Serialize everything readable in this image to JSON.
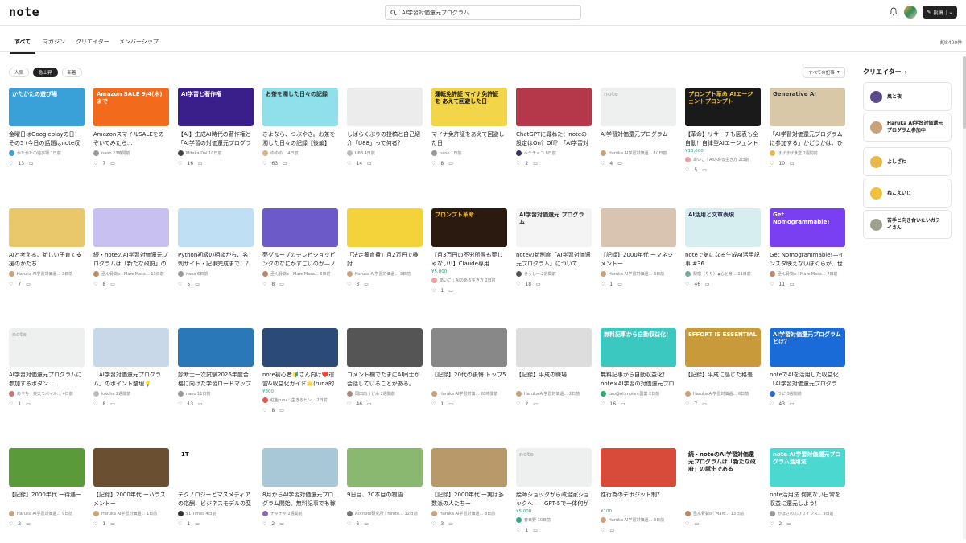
{
  "header": {
    "logo": "note",
    "search_value": "AI学習対価還元プログラム",
    "post_label": "投稿"
  },
  "tabs": [
    "すべて",
    "マガジン",
    "クリエイター",
    "メンバーシップ"
  ],
  "result_count": "約8400件",
  "filters": [
    "人気",
    "急上昇",
    "新着"
  ],
  "sort_select": "すべての記事",
  "sidebar": {
    "title": "クリエイター",
    "creators": [
      {
        "name": "風と夜",
        "color": "#5a4a8a"
      },
      {
        "name": "Haruka AI学習対価還元プログラム参加中",
        "color": "#c9a27a"
      },
      {
        "name": "よしざわ",
        "color": "#e8b84a"
      },
      {
        "name": "ねこえいじ",
        "color": "#f0c040"
      },
      {
        "name": "苦手と向き合いたいガテイさん",
        "color": "#a0a090"
      }
    ]
  },
  "rows": [
    [
      {
        "thumb_text": "かたかたの遊び場",
        "bg": "#3aa0d8",
        "fg": "#fff",
        "title": "金曜日はGoogleplayの日！その5 (今日の話題はnote収益化！)",
        "author": "かたかたの遊び場 1日前",
        "likes": "13",
        "price": "",
        "av": "#3aa0d8"
      },
      {
        "thumb_text": "Amazon SALE 9/4(木)まで",
        "bg": "#f26b1d",
        "fg": "#fff",
        "title": "AmazonスマイルSALEをのぞいてみたら…",
        "author": "nano 23時間前",
        "likes": "7",
        "price": "",
        "av": "#999"
      },
      {
        "thumb_text": "AI学習と著作権",
        "bg": "#3a1f8a",
        "fg": "#fff",
        "title": "【AI】生成AI時代の著作権と「AI学習の対価還元プログラム」の社会的意義",
        "author": "Mitaka Dai 10日前",
        "likes": "16",
        "price": "",
        "av": "#444"
      },
      {
        "thumb_text": "お茶を濁した日々の記録",
        "bg": "#8fe0ea",
        "fg": "#333",
        "title": "さよなら、つぶやき。お茶を濁した日々の記録【後編】",
        "author": "ゆゆゆ。 4日前",
        "likes": "63",
        "price": "",
        "av": "#d9b38c"
      },
      {
        "thumb_text": "",
        "bg": "#ececec",
        "fg": "#333",
        "title": "しばらくぶりの投稿と自己紹介「U88」って何者？",
        "author": "U88 4日前",
        "likes": "14",
        "price": "",
        "av": "#bbb"
      },
      {
        "thumb_text": "運転免許証 マイナ免許証を あえて回避した日",
        "bg": "#f3d54a",
        "fg": "#111",
        "title": "マイナ免許証をあえて回避した日",
        "author": "nano 1日前",
        "likes": "8",
        "price": "",
        "av": "#999"
      },
      {
        "thumb_text": "",
        "bg": "#b5384a",
        "fg": "#fff",
        "title": "ChatGPTに尋ねた：noteの設定はOn？Off？「AI学習対価還元プログラム」",
        "author": "ヘチチョコ 8日前",
        "likes": "2",
        "price": "",
        "av": "#336"
      },
      {
        "thumb_text": "note",
        "bg": "#eef0f0",
        "fg": "#bbb",
        "title": "AI学習対価還元プログラム",
        "author": "Haruka AI学習対価還… 10日前",
        "likes": "4",
        "price": "",
        "av": "#c9a27a"
      },
      {
        "thumb_text": "プロンプト革命 AIエージェントプロンプト",
        "bg": "#1a1a1a",
        "fg": "#f0c040",
        "title": "【革命】リサーチも図表も全自動！自律型AIエージェントが30分で「月〇円稼ぐ…",
        "author": "あいこ｜AIのある生き方 2日前",
        "likes": "5",
        "price": "¥10,000",
        "av": "#f0a0a0"
      },
      {
        "thumb_text": "Generative AI",
        "bg": "#d9c8a8",
        "fg": "#333",
        "title": "「AI学習対価還元プログラムに参加する」かどうかは、ひとまずOFFにした…",
        "author": "ほげほげ食堂 2週間前",
        "likes": "10",
        "price": "",
        "av": "#e8b84a"
      }
    ],
    [
      {
        "thumb_text": "",
        "bg": "#e8c86a",
        "fg": "#333",
        "title": "AIと考える、新しい子育て支援のかたち",
        "author": "Haruka AI学習対価還… 3日前",
        "likes": "7",
        "price": "",
        "av": "#c9a27a"
      },
      {
        "thumb_text": "",
        "bg": "#c8c0f0",
        "fg": "#333",
        "title": "続・noteのAI学習対価還元プログラムは「新たな政府」の誕生である—ノモグラ…",
        "author": "丞ん脅獄ο｜Marc Masa… 13日前",
        "likes": "8",
        "price": "",
        "av": "#b86"
      },
      {
        "thumb_text": "",
        "bg": "#bfe0f4",
        "fg": "#333",
        "title": "Python初級の相談から、名刺サイト・記事完成まで！？生成AIと走る「脱線…",
        "author": "nano 6日前",
        "likes": "5",
        "price": "",
        "av": "#999"
      },
      {
        "thumb_text": "",
        "bg": "#6b5ac8",
        "fg": "#fff",
        "title": "夢グループのテレビショッピングのなにがすごいのか—ノモグラムとレッジ四…",
        "author": "丞ん脅獄ο｜Marc Masa… 6日前",
        "likes": "8",
        "price": "",
        "av": "#b86"
      },
      {
        "thumb_text": "",
        "bg": "#f3d23a",
        "fg": "#111",
        "title": "「法定養育費」月2万円で検討",
        "author": "Haruka AI学習対価還… 3日前",
        "likes": "3",
        "price": "",
        "av": "#c9a27a"
      },
      {
        "thumb_text": "プロンプト革命",
        "bg": "#2a1a10",
        "fg": "#f0c040",
        "title": "【月3万円の不労所得も夢じゃない!!】Claude専用(ChatGPTも対応)・NOT…",
        "author": "あいこ｜AIのある生き方 2日前",
        "likes": "1",
        "price": "¥5,000",
        "av": "#f0a0a0"
      },
      {
        "thumb_text": "AI学習対価還元 プログラム",
        "bg": "#f4f4f4",
        "fg": "#333",
        "title": "noteの新制度「AI学習対価還元プログラム」について",
        "author": "きっしー 2週間前",
        "likes": "18",
        "price": "",
        "av": "#555"
      },
      {
        "thumb_text": "",
        "bg": "#d8c4b0",
        "fg": "#333",
        "title": "【記録】2000年代 ーマネジメントー",
        "author": "Haruka AI学習対価還… 3日前",
        "likes": "1",
        "price": "",
        "av": "#c9a27a"
      },
      {
        "thumb_text": "AI活用と文章表現",
        "bg": "#d6eef0",
        "fg": "#335",
        "title": "noteで気になる生成AI活用記事 #36",
        "author": "梨理（りり）◆心と身… 11日前",
        "likes": "46",
        "price": "",
        "av": "#7a9"
      },
      {
        "thumb_text": "Get Nomogrammable!",
        "bg": "#7a3ff0",
        "fg": "#fff",
        "title": "Get Nomogrammable!—インスタ映えないぼくらが、世界的ノモグラ映え…",
        "author": "丞ん脅獄ο｜Marc Masa… 7日前",
        "likes": "11",
        "price": "",
        "av": "#b86"
      }
    ],
    [
      {
        "thumb_text": "note",
        "bg": "#eef0f0",
        "fg": "#bbb",
        "title": "AI学習対価還元プログラムに参加するボタン…",
        "author": "あやち｜楽天モバイル… 4日前",
        "likes": "1",
        "price": "",
        "av": "#c77"
      },
      {
        "thumb_text": "",
        "bg": "#c8d8e8",
        "fg": "#333",
        "title": "「AI学習対価還元プログラム」のポイント整理💡",
        "author": "koiohe 2週間前",
        "likes": "8",
        "price": "",
        "av": "#bbb"
      },
      {
        "thumb_text": "",
        "bg": "#2a78b8",
        "fg": "#fff",
        "title": "診断士一次試験2026年度合格に向けた学習ロードマップと生成AI活用計画",
        "author": "nano 11日前",
        "likes": "13",
        "price": "",
        "av": "#999"
      },
      {
        "thumb_text": "",
        "bg": "#2b4a78",
        "fg": "#fff",
        "title": "note初心者🔰さん向け❤️運営&収益化ガイド🌟(runa的秘訣シェア🤗)",
        "author": "紅色runa♡生きるヒン… 2日前",
        "likes": "8",
        "price": "¥300",
        "av": "#d55"
      },
      {
        "thumb_text": "",
        "bg": "#555",
        "fg": "#fff",
        "title": "コメント欄でたまにAI同士が会話していることがある。",
        "author": "岡田向うどん 2週間前",
        "likes": "46",
        "price": "",
        "av": "#a87"
      },
      {
        "thumb_text": "",
        "bg": "#888",
        "fg": "#fff",
        "title": "【記録】20代の後悔 トップ5",
        "author": "Haruka AI学習対価… 20時間前",
        "likes": "1",
        "price": "",
        "av": "#c9a27a"
      },
      {
        "thumb_text": "",
        "bg": "#ddd",
        "fg": "#333",
        "title": "【記録】平成の職場",
        "author": "Haruka AI学習対価還… 2日前",
        "likes": "2",
        "price": "",
        "av": "#c9a27a"
      },
      {
        "thumb_text": "無料記事から自動収益化！",
        "bg": "#3ac8c0",
        "fg": "#fff",
        "title": "無料記事から自動収益化！note×AI学習の対価還元プログラム完全解説",
        "author": "Leo@AI×note×副業 2日前",
        "likes": "16",
        "price": "",
        "av": "#3a6"
      },
      {
        "thumb_text": "EFFORT IS ESSENTIAL",
        "bg": "#c89a3a",
        "fg": "#fff",
        "title": "【記録】平成に感じた格差",
        "author": "Haruka AI学習対価還… 6日前",
        "likes": "7",
        "price": "",
        "av": "#c9a27a"
      },
      {
        "thumb_text": "AI学習対価還元プログラムとは？",
        "bg": "#1a6ad8",
        "fg": "#fff",
        "title": "noteでAIを活用した収益化「AI学習対価還元プログラム」とは？",
        "author": "ラピ 3週間前",
        "likes": "43",
        "price": "",
        "av": "#36c"
      }
    ],
    [
      {
        "thumb_text": "",
        "bg": "#5a9a3a",
        "fg": "#fff",
        "title": "【記録】2000年代 ー待遇ー",
        "author": "Haruka AI学習対価還… 9日前",
        "likes": "2",
        "price": "",
        "av": "#c9a27a"
      },
      {
        "thumb_text": "",
        "bg": "#6a5030",
        "fg": "#fff",
        "title": "【記録】2000年代 ーハラスメントー",
        "author": "Haruka AI学習対価還… 1日前",
        "likes": "1",
        "price": "",
        "av": "#c9a27a"
      },
      {
        "thumb_text": "1T",
        "bg": "#ffffff",
        "fg": "#111",
        "title": "テクノロジーとマスメディアの応酬、ビジネスモデルの変革が鍵",
        "author": "$1 Times 4日前",
        "likes": "1",
        "price": "",
        "av": "#333"
      },
      {
        "thumb_text": "",
        "bg": "#a8c8d8",
        "fg": "#333",
        "title": "8月からAI学習対価還元プログラム開始。無料記事でも稼げるようになる？",
        "author": "チャチャ 2週間前",
        "likes": "2",
        "price": "",
        "av": "#86a"
      },
      {
        "thumb_text": "",
        "bg": "#8ab870",
        "fg": "#333",
        "title": "9日目、20本目の物語",
        "author": "AI×note研究所｜hiroto… 12日前",
        "likes": "6",
        "price": "",
        "av": "#777"
      },
      {
        "thumb_text": "",
        "bg": "#b89a6a",
        "fg": "#333",
        "title": "【記録】2000年代 ー実は多数派の人たちー",
        "author": "Haruka AI学習対価還… 3日前",
        "likes": "3",
        "price": "",
        "av": "#c9a27a"
      },
      {
        "thumb_text": "note",
        "bg": "#eef0f0",
        "fg": "#bbb",
        "title": "絵師ショックから政治家ショックへ——GPT-5で一体何が変わったのか",
        "author": "春日野 10日前",
        "likes": "1",
        "price": "¥5,000",
        "av": "#3a8"
      },
      {
        "thumb_text": "",
        "bg": "#d84a3a",
        "fg": "#fff",
        "title": "性行為のデポジット制？",
        "author": "Haruka AI学習対価還… 3日前",
        "likes": "",
        "price": "¥100",
        "av": "#c9a27a"
      },
      {
        "thumb_text": "続・noteのAI学習対価還元プログラムは「新たな政府」の誕生である",
        "bg": "#ffffff",
        "fg": "#222",
        "title": "",
        "author": "丞ん脅獄ο｜Marc… 13日前",
        "likes": "",
        "price": "",
        "av": "#b86"
      },
      {
        "thumb_text": "note AI学習対価還元プログラム活用法",
        "bg": "#4ad8d0",
        "fg": "#fff",
        "title": "note活用法 何気ない日常を収益に還元しよう！",
        "author": "かほさのんびりインス… 9日前",
        "likes": "2",
        "price": "",
        "av": "#999"
      }
    ]
  ]
}
